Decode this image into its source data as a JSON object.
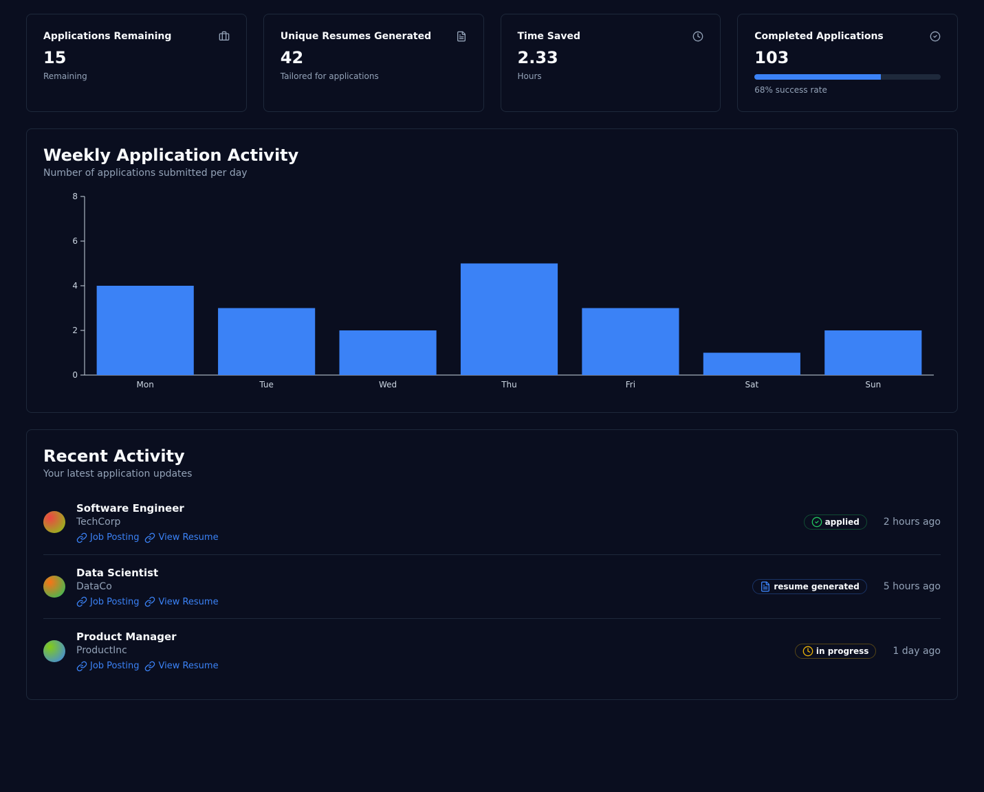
{
  "stats": [
    {
      "title": "Applications Remaining",
      "value": "15",
      "sub": "Remaining",
      "icon": "briefcase"
    },
    {
      "title": "Unique Resumes Generated",
      "value": "42",
      "sub": "Tailored for applications",
      "icon": "file"
    },
    {
      "title": "Time Saved",
      "value": "2.33",
      "sub": "Hours",
      "icon": "clock"
    },
    {
      "title": "Completed Applications",
      "value": "103",
      "sub": "68% success rate",
      "icon": "check-circle",
      "progress": 68
    }
  ],
  "weekly_activity": {
    "title": "Weekly Application Activity",
    "sub": "Number of applications submitted per day"
  },
  "chart_data": {
    "type": "bar",
    "categories": [
      "Mon",
      "Tue",
      "Wed",
      "Thu",
      "Fri",
      "Sat",
      "Sun"
    ],
    "values": [
      4,
      3,
      2,
      5,
      3,
      1,
      2
    ],
    "xlabel": "",
    "ylabel": "",
    "ylim": [
      0,
      8
    ],
    "yticks": [
      0,
      2,
      4,
      6,
      8
    ]
  },
  "recent": {
    "title": "Recent Activity",
    "sub": "Your latest application updates",
    "link_job": "Job Posting",
    "link_resume": "View Resume",
    "items": [
      {
        "title": "Software Engineer",
        "company": "TechCorp",
        "status": "applied",
        "status_icon": "check-circle",
        "status_color": "#22c55e",
        "time": "2 hours ago",
        "avatar_g": [
          "#ef4444",
          "#84cc16"
        ]
      },
      {
        "title": "Data Scientist",
        "company": "DataCo",
        "status": "resume generated",
        "status_icon": "file",
        "status_color": "#3b82f6",
        "time": "5 hours ago",
        "avatar_g": [
          "#f97316",
          "#22c55e"
        ]
      },
      {
        "title": "Product Manager",
        "company": "ProductInc",
        "status": "in progress",
        "status_icon": "clock",
        "status_color": "#eab308",
        "time": "1 day ago",
        "avatar_g": [
          "#84cc16",
          "#3b82f6"
        ]
      }
    ]
  }
}
